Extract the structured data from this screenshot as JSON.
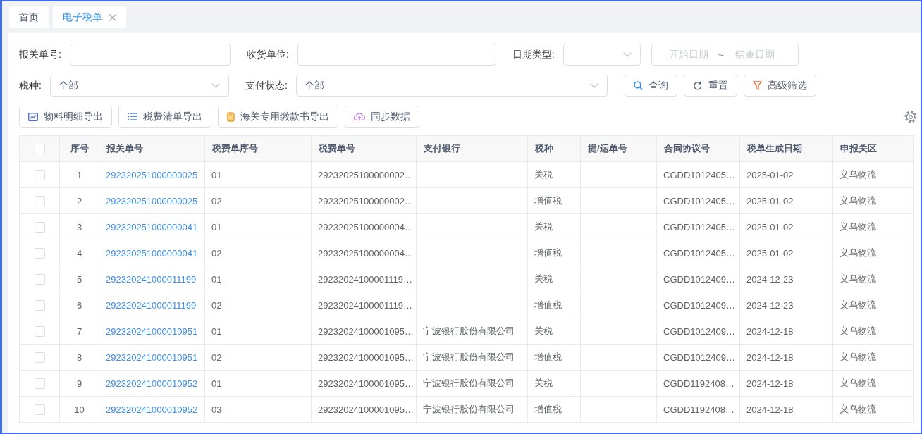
{
  "tabs": [
    {
      "label": "首页",
      "selected": false,
      "closable": false
    },
    {
      "label": "电子税单",
      "selected": true,
      "closable": true
    }
  ],
  "filter_rows": [
    [
      {
        "kind": "input",
        "label": "报关单号:"
      },
      {
        "kind": "input",
        "label": "收货单位:"
      },
      {
        "kind": "select",
        "label": "日期类型:"
      },
      {
        "kind": "daterange",
        "start_placeholder": "开始日期",
        "separator": "~",
        "end_placeholder": "结束日期"
      }
    ],
    [
      {
        "kind": "select",
        "label": "税种:",
        "value": "全部"
      },
      {
        "kind": "select",
        "label": "支付状态:",
        "value": "全部"
      }
    ]
  ],
  "filter_buttons": [
    "查询",
    "重置",
    "高级筛选"
  ],
  "toolbar_buttons": [
    "物料明细导出",
    "税费清单导出",
    "海关专用缴款书导出",
    "同步数据"
  ],
  "table": {
    "all_checked": false,
    "columns": [
      {
        "label": "序号",
        "kind": "index"
      },
      {
        "label": "报关单号",
        "kind": "link"
      },
      {
        "label": "税费单序号",
        "kind": "text"
      },
      {
        "label": "税费单号",
        "kind": "text"
      },
      {
        "label": "支付银行",
        "kind": "text"
      },
      {
        "label": "税种",
        "kind": "text"
      },
      {
        "label": "提/运单号",
        "kind": "text"
      },
      {
        "label": "合同协议号",
        "kind": "text"
      },
      {
        "label": "税单生成日期",
        "kind": "text"
      },
      {
        "label": "申报关区",
        "kind": "text"
      }
    ],
    "rows": [
      {
        "checked": false,
        "cells": [
          "1",
          "292320251000000025",
          "01",
          "29232025100000002…",
          null,
          "关税",
          null,
          "CGDD1012405…",
          "2025-01-02",
          "义乌物流"
        ]
      },
      {
        "checked": false,
        "cells": [
          "2",
          "292320251000000025",
          "02",
          "29232025100000002…",
          null,
          "增值税",
          null,
          "CGDD1012405…",
          "2025-01-02",
          "义乌物流"
        ]
      },
      {
        "checked": false,
        "cells": [
          "3",
          "292320251000000041",
          "01",
          "29232025100000004…",
          null,
          "关税",
          null,
          "CGDD1012405…",
          "2025-01-02",
          "义乌物流"
        ]
      },
      {
        "checked": false,
        "cells": [
          "4",
          "292320251000000041",
          "02",
          "29232025100000004…",
          null,
          "增值税",
          null,
          "CGDD1012405…",
          "2025-01-02",
          "义乌物流"
        ]
      },
      {
        "checked": false,
        "cells": [
          "5",
          "292320241000011199",
          "01",
          "29232024100001119…",
          null,
          "关税",
          null,
          "CGDD1012409…",
          "2024-12-23",
          "义乌物流"
        ]
      },
      {
        "checked": false,
        "cells": [
          "6",
          "292320241000011199",
          "02",
          "29232024100001119…",
          null,
          "增值税",
          null,
          "CGDD1012409…",
          "2024-12-23",
          "义乌物流"
        ]
      },
      {
        "checked": false,
        "cells": [
          "7",
          "292320241000010951",
          "01",
          "29232024100001095…",
          "宁波银行股份有限公司",
          "关税",
          null,
          "CGDD1012409…",
          "2024-12-18",
          "义乌物流"
        ]
      },
      {
        "checked": false,
        "cells": [
          "8",
          "292320241000010951",
          "02",
          "29232024100001095…",
          "宁波银行股份有限公司",
          "增值税",
          null,
          "CGDD1012409…",
          "2024-12-18",
          "义乌物流"
        ]
      },
      {
        "checked": false,
        "cells": [
          "9",
          "292320241000010952",
          "01",
          "29232024100001095…",
          "宁波银行股份有限公司",
          "关税",
          null,
          "CGDD1192408…",
          "2024-12-18",
          "义乌物流"
        ]
      },
      {
        "checked": false,
        "cells": [
          "10",
          "292320241000010952",
          "03",
          "29232024100001095…",
          "宁波银行股份有限公司",
          "增值税",
          null,
          "CGDD1192408…",
          "2024-12-18",
          "义乌物流"
        ]
      }
    ]
  }
}
